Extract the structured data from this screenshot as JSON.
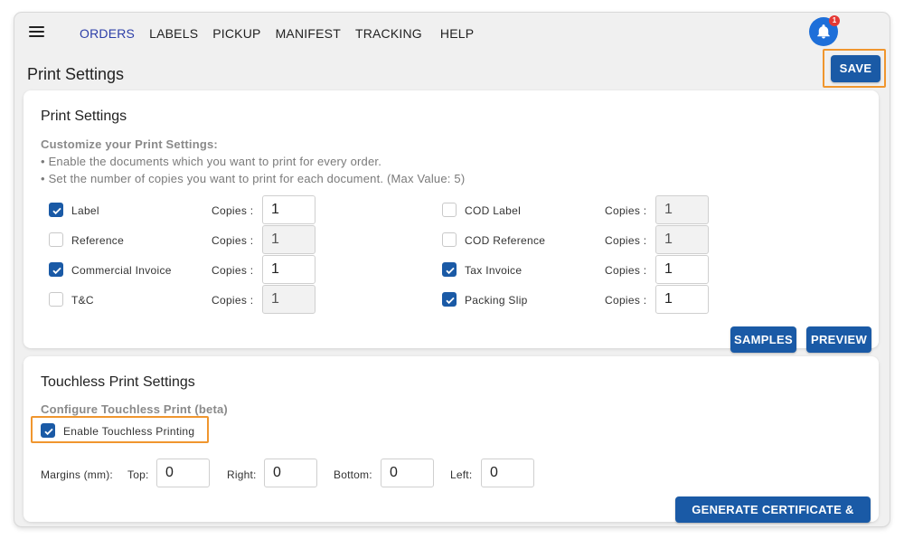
{
  "nav": {
    "items": [
      "ORDERS",
      "LABELS",
      "PICKUP",
      "MANIFEST",
      "TRACKING",
      "HELP"
    ],
    "active": "ORDERS",
    "accent": "#2d3fa8"
  },
  "notifications": {
    "count": "1",
    "icon": "bell-icon",
    "color": "#1e6fd9"
  },
  "page": {
    "title": "Print Settings",
    "save_label": "SAVE"
  },
  "print_settings": {
    "title": "Print Settings",
    "subheading": "Customize your Print Settings:",
    "notes": [
      "• Enable the documents which you want to print for every order.",
      "• Set the number of copies you want to print for each document. (Max Value: 5)"
    ],
    "copies_label": "Copies :",
    "left_docs": [
      {
        "label": "Label",
        "checked": true,
        "copies": "1"
      },
      {
        "label": "Reference",
        "checked": false,
        "copies": "1"
      },
      {
        "label": "Commercial Invoice",
        "checked": true,
        "copies": "1"
      },
      {
        "label": "T&C",
        "checked": false,
        "copies": "1"
      }
    ],
    "right_docs": [
      {
        "label": "COD Label",
        "checked": false,
        "copies": "1"
      },
      {
        "label": "COD Reference",
        "checked": false,
        "copies": "1"
      },
      {
        "label": "Tax Invoice",
        "checked": true,
        "copies": "1"
      },
      {
        "label": "Packing Slip",
        "checked": true,
        "copies": "1"
      }
    ],
    "samples_label": "SAMPLES",
    "preview_label": "PREVIEW"
  },
  "touchless": {
    "title": "Touchless Print Settings",
    "subheading": "Configure Touchless Print (beta)",
    "enable_label": "Enable Touchless Printing",
    "enabled": true,
    "margins_label": "Margins (mm):",
    "top_label": "Top:",
    "top_value": "0",
    "right_label": "Right:",
    "right_value": "0",
    "bottom_label": "Bottom:",
    "bottom_value": "0",
    "left_label": "Left:",
    "left_value": "0",
    "generate_label": "GENERATE CERTIFICATE & KEYS"
  },
  "colors": {
    "primary_button": "#1a5aa6",
    "highlight": "#f0962e"
  }
}
